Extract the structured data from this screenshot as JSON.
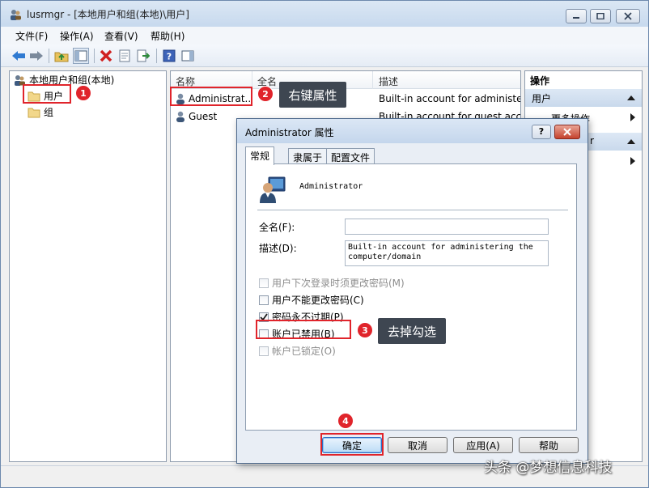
{
  "window": {
    "title": "lusrmgr - [本地用户和组(本地)\\用户]"
  },
  "menu": [
    "文件(F)",
    "操作(A)",
    "查看(V)",
    "帮助(H)"
  ],
  "tree": {
    "root": "本地用户和组(本地)",
    "users": "用户",
    "groups": "组"
  },
  "list": {
    "columns": [
      "名称",
      "全名",
      "描述"
    ],
    "rows": [
      {
        "name": "Administrat...",
        "fullname": "",
        "desc": "Built-in account for administer"
      },
      {
        "name": "Guest",
        "fullname": "",
        "desc": "Built-in account for guest acce"
      }
    ]
  },
  "actions": {
    "header": "操作",
    "section1": "用户",
    "item1": "更多操作",
    "section2_tail": "r"
  },
  "dialog": {
    "title": "Administrator 属性",
    "help_label": "?",
    "tabs": [
      "常规",
      "隶属于",
      "配置文件"
    ],
    "username": "Administrator",
    "fullname_label": "全名(F):",
    "fullname_value": "",
    "desc_label": "描述(D):",
    "desc_value": "Built-in account for administering the computer/domain",
    "checkboxes": [
      {
        "label": "用户下次登录时须更改密码(M)",
        "checked": false,
        "disabled": true
      },
      {
        "label": "用户不能更改密码(C)",
        "checked": false,
        "disabled": false
      },
      {
        "label": "密码永不过期(P)",
        "checked": true,
        "disabled": false
      },
      {
        "label": "账户已禁用(B)",
        "checked": false,
        "disabled": false
      },
      {
        "label": "帐户已锁定(O)",
        "checked": false,
        "disabled": true
      }
    ],
    "buttons": {
      "ok": "确定",
      "cancel": "取消",
      "apply": "应用(A)",
      "help": "帮助"
    }
  },
  "annotations": {
    "badges": [
      "1",
      "2",
      "3",
      "4"
    ],
    "callout_right_click": "右键属性",
    "callout_uncheck": "去掉勾选"
  },
  "watermark": "头条 @梦想信息科技",
  "colors": {
    "annotation_red": "#e0242b",
    "callout_bg": "#3e4651"
  }
}
